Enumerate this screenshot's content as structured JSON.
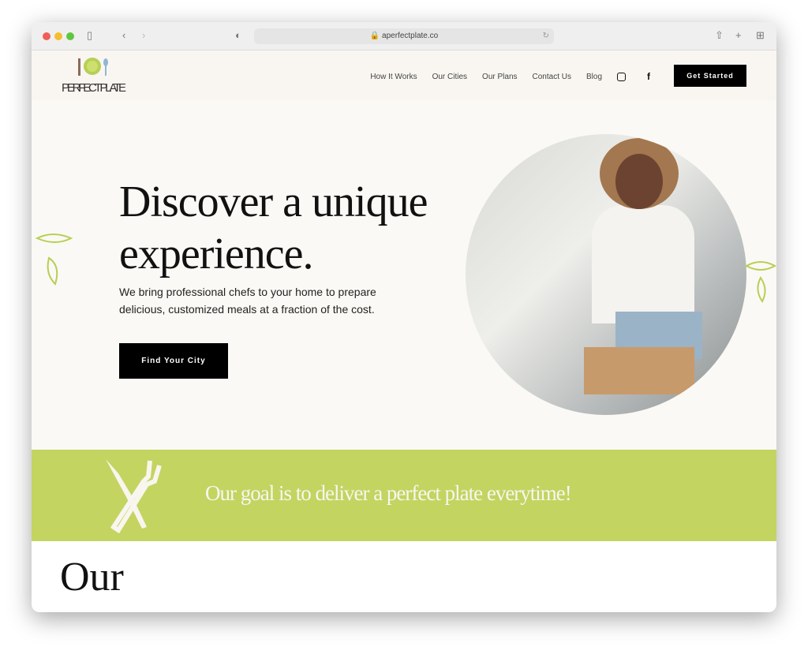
{
  "browser": {
    "url": "aperfectplate.co"
  },
  "nav": {
    "logo_text": "THE PERFECT PLATE",
    "links": [
      "How It Works",
      "Our Cities",
      "Our Plans",
      "Contact Us",
      "Blog"
    ],
    "cta": "Get Started"
  },
  "hero": {
    "title_line1": "Discover a unique",
    "title_line2": "experience.",
    "subtitle": "We bring professional chefs to your home to prepare delicious, customized meals at a fraction of the cost.",
    "button": "Find Your City"
  },
  "band": {
    "text": "Our goal is to deliver a perfect plate everytime!"
  },
  "next_section": {
    "title": "Our"
  },
  "colors": {
    "accent": "#c3d461",
    "button": "#000000",
    "nav_bg": "#f9f6f1"
  }
}
